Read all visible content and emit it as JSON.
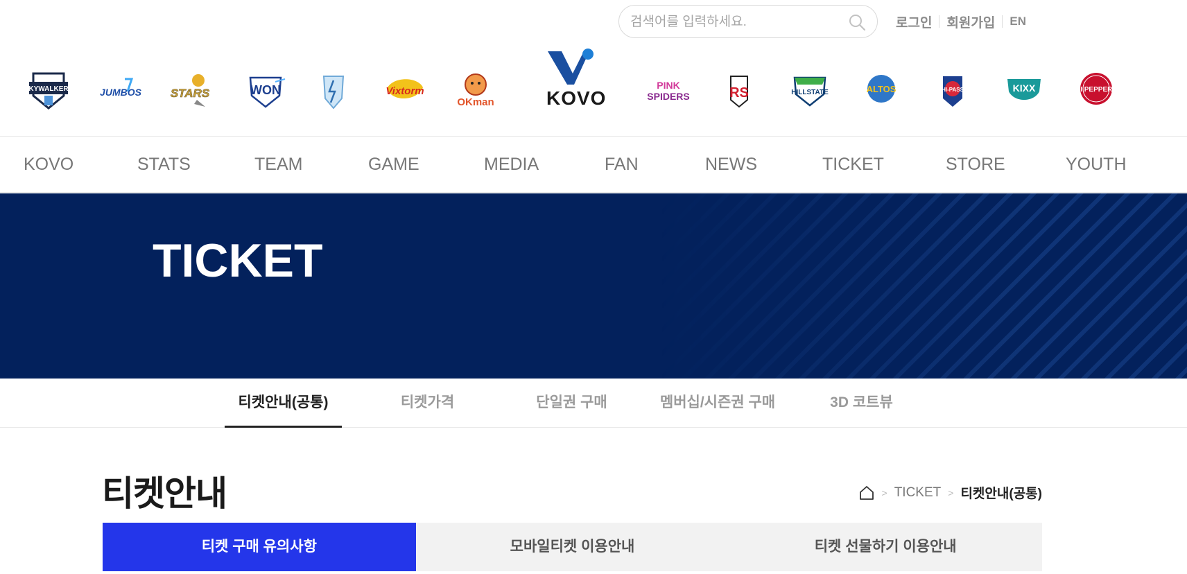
{
  "search": {
    "placeholder": "검색어를 입력하세요."
  },
  "util": {
    "login": "로그인",
    "join": "회원가입",
    "lang": "EN"
  },
  "teams": [
    {
      "name": "SKY WALKERS",
      "icon": "skywalkers-logo-icon",
      "color": "#1b2a4a"
    },
    {
      "name": "JUMBOS",
      "icon": "jumbos-logo-icon",
      "color": "#1f4fa8"
    },
    {
      "name": "KB STARS",
      "icon": "kbstars-logo-icon",
      "color": "#c8a03a"
    },
    {
      "name": "WOORI WON",
      "icon": "wooriwon-logo-icon",
      "color": "#1d3f8f"
    },
    {
      "name": "THUNDERS",
      "icon": "thunders-logo-icon",
      "color": "#6fa9d8"
    },
    {
      "name": "KEPCO VIXTORM",
      "icon": "vixtorm-logo-icon",
      "color": "#d7281c"
    },
    {
      "name": "OK man",
      "icon": "okman-logo-icon",
      "color": "#e2552b"
    },
    {
      "name": "PINK SPIDERS",
      "icon": "pinkspiders-logo-icon",
      "color": "#8a2a8f"
    },
    {
      "name": "RED SPARKS",
      "icon": "redsparks-logo-icon",
      "color": "#d2202f"
    },
    {
      "name": "HILLSTATE",
      "icon": "hillstate-logo-icon",
      "color": "#0f3e73"
    },
    {
      "name": "ALTOS",
      "icon": "altos-logo-icon",
      "color": "#2f77c8"
    },
    {
      "name": "HI-PASS",
      "icon": "hipass-logo-icon",
      "color": "#d8283a"
    },
    {
      "name": "KIXX",
      "icon": "kixx-logo-icon",
      "color": "#1a9a9a"
    },
    {
      "name": "AI PEPPERS",
      "icon": "aipeppers-logo-icon",
      "color": "#c8102e"
    }
  ],
  "brand": {
    "name": "KOVO",
    "primary": "#1a4fa0",
    "accent": "#1e7fd6"
  },
  "gnb": [
    "KOVO",
    "STATS",
    "TEAM",
    "GAME",
    "MEDIA",
    "FAN",
    "NEWS",
    "TICKET",
    "STORE",
    "YOUTH"
  ],
  "hero": {
    "title": "TICKET",
    "bg": "#03215c"
  },
  "subtabs": [
    "티켓안내(공통)",
    "티켓가격",
    "단일권 구매",
    "멤버십/시즌권 구매",
    "3D 코트뷰"
  ],
  "page": {
    "title": "티켓안내"
  },
  "breadcrumb": {
    "level1": "TICKET",
    "current": "티켓안내(공통)"
  },
  "content_tabs": [
    "티켓 구매 유의사항",
    "모바일티켓 이용안내",
    "티켓 선물하기 이용안내"
  ],
  "colors": {
    "tab_active": "#2436ea",
    "tab_inactive": "#f2f2f2"
  }
}
